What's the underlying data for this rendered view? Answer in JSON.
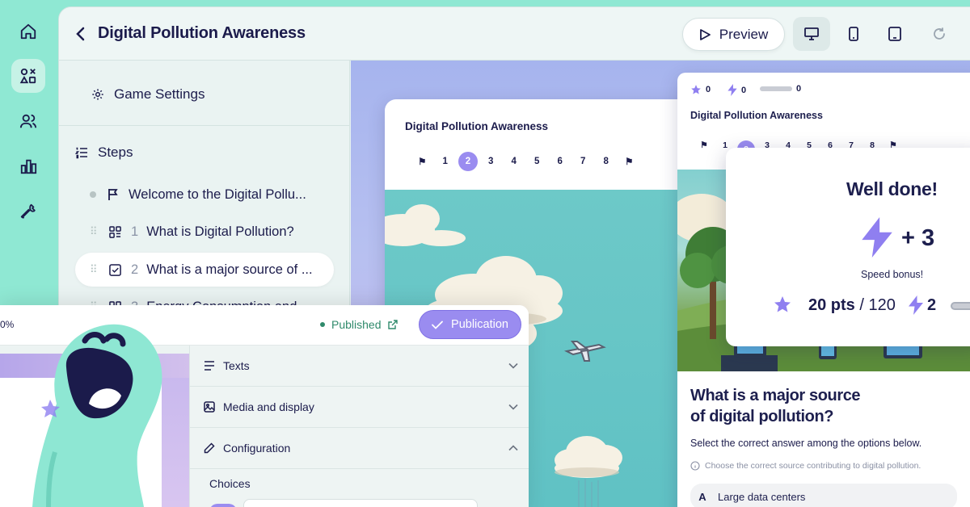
{
  "rail": {
    "items": [
      "home-icon",
      "shapes-icon",
      "users-icon",
      "stats-icon",
      "tools-icon"
    ]
  },
  "header": {
    "title": "Digital Pollution Awareness",
    "preview_label": "Preview"
  },
  "steps_panel": {
    "game_settings_label": "Game Settings",
    "steps_label": "Steps",
    "steps": [
      {
        "num": "",
        "label": "Welcome to the Digital Pollu..."
      },
      {
        "num": "1",
        "label": "What is Digital Pollution?"
      },
      {
        "num": "2",
        "label": "What is a major source of ..."
      },
      {
        "num": "3",
        "label": "Energy Consumption and"
      }
    ]
  },
  "game_card": {
    "title": "Digital Pollution Awareness",
    "steps": [
      "1",
      "2",
      "3",
      "4",
      "5",
      "6",
      "7",
      "8"
    ],
    "current_step": "2"
  },
  "phone": {
    "stars": "0",
    "bolts": "0",
    "progress": "0",
    "title": "Digital Pollution Awareness",
    "steps": [
      "1",
      "2",
      "3",
      "4",
      "5",
      "6",
      "7",
      "8"
    ],
    "current_step": "2",
    "question_line1": "What is a major source",
    "question_line2": "of digital pollution?",
    "instruction": "Select the correct answer among the options below.",
    "hint": "Choose the correct source contributing to digital pollution.",
    "answers": [
      {
        "letter": "A",
        "text": "Large data centers"
      }
    ]
  },
  "popup": {
    "title": "Well done!",
    "bonus": "+ 3",
    "bonus_label": "Speed bonus!",
    "points": "20 pts",
    "points_total": "/ 120",
    "level": "2"
  },
  "config": {
    "zoom": "0%",
    "status": "Published",
    "publish_label": "Publication",
    "sections": [
      "Texts",
      "Media and display",
      "Configuration"
    ],
    "choices_label": "Choices"
  },
  "colors": {
    "accent": "#9a8cf0",
    "mint": "#8fe8d3",
    "navy": "#1b1b4b",
    "published": "#2f8a6b"
  }
}
